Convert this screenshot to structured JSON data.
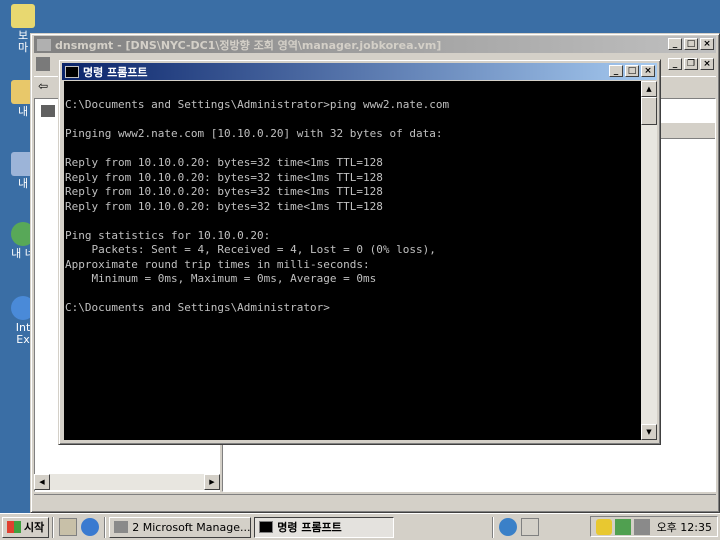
{
  "desktop": {
    "icons": [
      {
        "label": "보\n마",
        "icon": "my-documents-icon"
      },
      {
        "label": "내",
        "icon": "my-computer-icon"
      },
      {
        "label": "내",
        "icon": "my-network-icon"
      },
      {
        "label": "내 네",
        "icon": "network-places-icon"
      },
      {
        "label": "Int\nEx",
        "icon": "internet-explorer-icon"
      }
    ]
  },
  "dnsmgmt": {
    "title": "dnsmgmt - [DNS\\NYC-DC1\\정방향 조회 영역\\manager.jobkorea.vm]"
  },
  "cmd": {
    "title": "명령 프롬프트",
    "lines": [
      "C:\\Documents and Settings\\Administrator>ping www2.nate.com",
      "",
      "Pinging www2.nate.com [10.10.0.20] with 32 bytes of data:",
      "",
      "Reply from 10.10.0.20: bytes=32 time<1ms TTL=128",
      "Reply from 10.10.0.20: bytes=32 time<1ms TTL=128",
      "Reply from 10.10.0.20: bytes=32 time<1ms TTL=128",
      "Reply from 10.10.0.20: bytes=32 time<1ms TTL=128",
      "",
      "Ping statistics for 10.10.0.20:",
      "    Packets: Sent = 4, Received = 4, Lost = 0 (0% loss),",
      "Approximate round trip times in milli-seconds:",
      "    Minimum = 0ms, Maximum = 0ms, Average = 0ms",
      "",
      "C:\\Documents and Settings\\Administrator>"
    ]
  },
  "taskbar": {
    "start_label": "시작",
    "tasks": [
      {
        "label": "2 Microsoft Manage...",
        "icon": "mmc-icon"
      },
      {
        "label": "명령 프롬프트",
        "icon": "cmd-icon"
      }
    ],
    "clock": "오후 12:35"
  },
  "colors": {
    "desktop": "#3a6ea5",
    "active_title": "#0a246a",
    "console_bg": "#000000",
    "console_fg": "#c0c0c0"
  }
}
